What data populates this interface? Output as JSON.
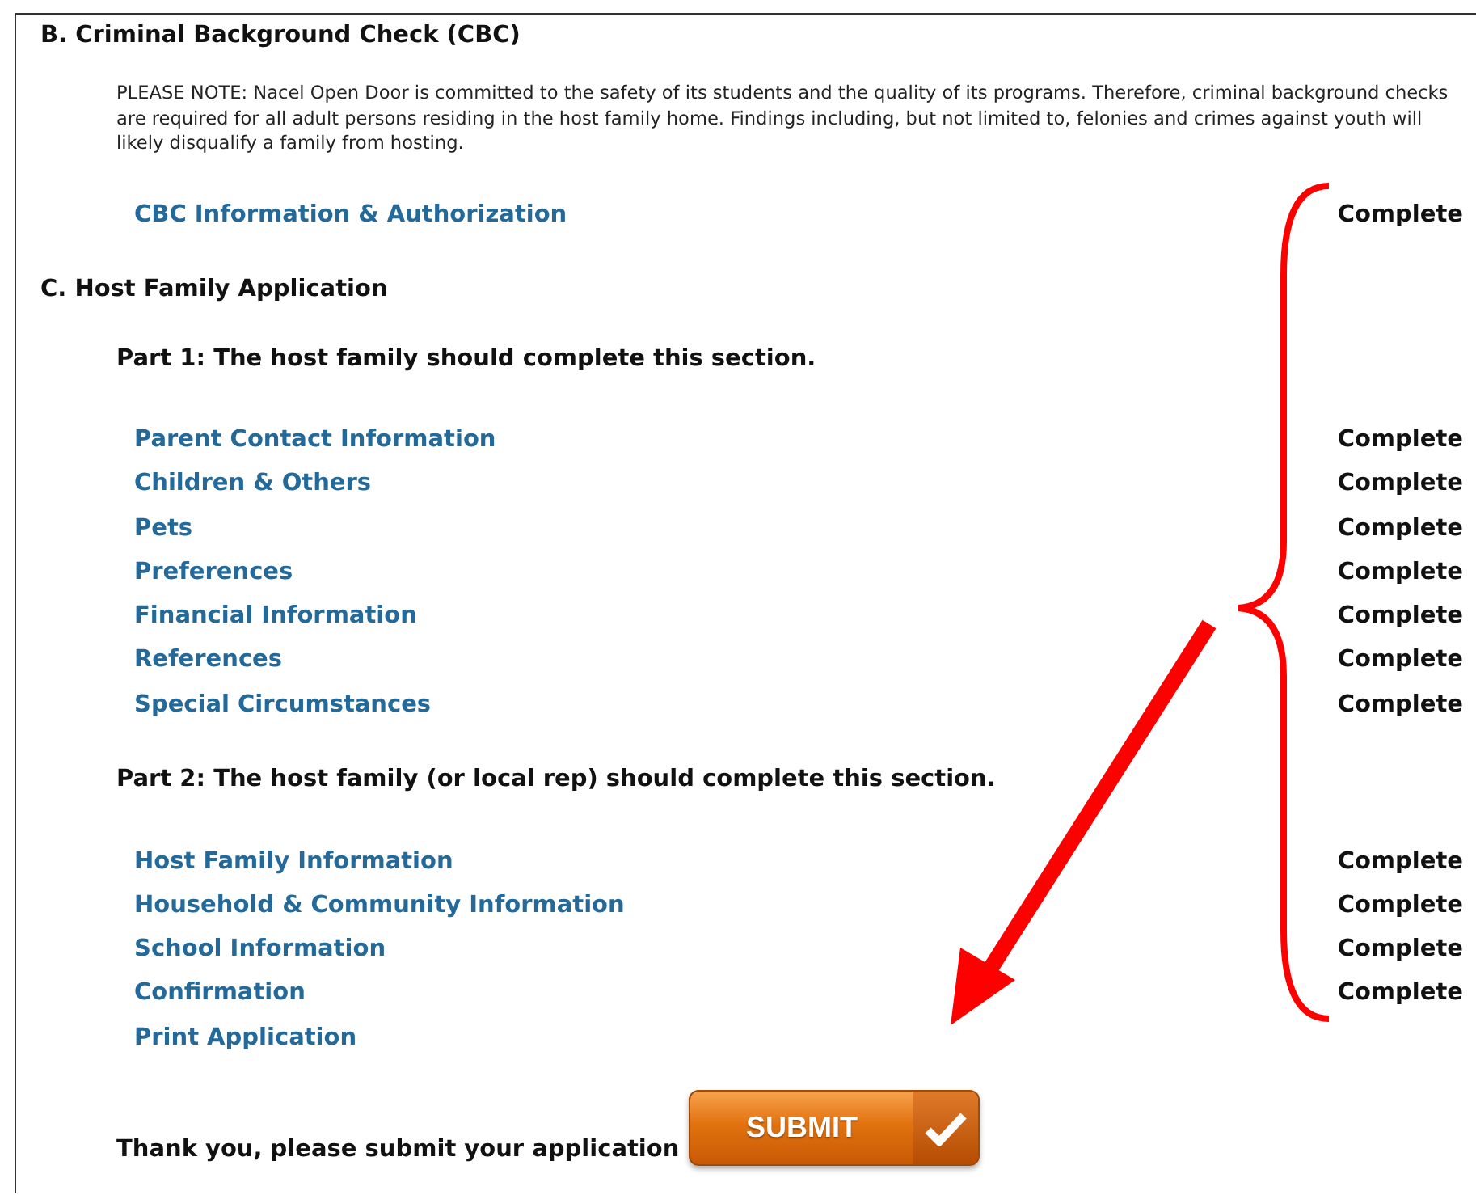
{
  "sections": [
    {
      "heading": "B. Criminal Background Check (CBC)",
      "note": "PLEASE NOTE: Nacel Open Door is committed to the safety of its students and the quality of its programs. Therefore, criminal background checks are required for all adult persons residing in the host family home. Findings including, but not limited to, felonies and crimes against youth will likely disqualify a family from hosting.",
      "groups": [
        {
          "items": [
            {
              "label": "CBC Information & Authorization",
              "status": "Complete"
            }
          ]
        }
      ]
    },
    {
      "heading": "C. Host Family Application",
      "groups": [
        {
          "heading": "Part 1: The host family should complete this section.",
          "items": [
            {
              "label": "Parent Contact Information",
              "status": "Complete"
            },
            {
              "label": "Children & Others",
              "status": "Complete"
            },
            {
              "label": "Pets",
              "status": "Complete"
            },
            {
              "label": "Preferences",
              "status": "Complete"
            },
            {
              "label": "Financial Information",
              "status": "Complete"
            },
            {
              "label": "References",
              "status": "Complete"
            },
            {
              "label": "Special Circumstances",
              "status": "Complete"
            }
          ]
        },
        {
          "heading": "Part 2: The host family (or local rep) should complete this section.",
          "items": [
            {
              "label": "Host Family Information",
              "status": "Complete"
            },
            {
              "label": "Household & Community Information",
              "status": "Complete"
            },
            {
              "label": "School Information",
              "status": "Complete"
            },
            {
              "label": "Confirmation",
              "status": "Complete"
            },
            {
              "label": "Print Application"
            }
          ]
        }
      ]
    }
  ],
  "footer": {
    "message": "Thank you, please submit your application",
    "submit_button": "SUBMIT"
  }
}
